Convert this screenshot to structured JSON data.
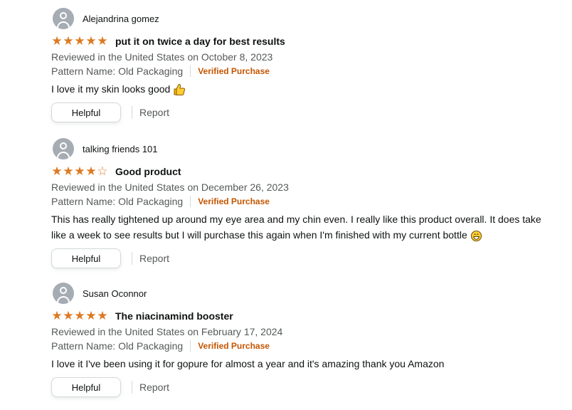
{
  "reviews": [
    {
      "profile_name": "Alejandrina gomez",
      "rating": 5,
      "title": "put it on twice a day for best results",
      "reviewed_line": "Reviewed in the United States on October 8, 2023",
      "pattern": "Pattern Name: Old Packaging",
      "verified": "Verified Purchase",
      "body": "I love it my skin looks good",
      "emoji": "thumbs-up",
      "helpful_label": "Helpful",
      "report_label": "Report"
    },
    {
      "profile_name": "talking friends 101",
      "rating": 4,
      "title": "Good product",
      "reviewed_line": "Reviewed in the United States on December 26, 2023",
      "pattern": "Pattern Name: Old Packaging",
      "verified": "Verified Purchase",
      "body": "This has really tightened up around my eye area and my chin even. I really like this product overall. It does take like a week to see results but I will purchase this again when I'm finished with my current bottle",
      "emoji": "grinning-face",
      "helpful_label": "Helpful",
      "report_label": "Report"
    },
    {
      "profile_name": "Susan Oconnor",
      "rating": 5,
      "title": "The niacinamind booster",
      "reviewed_line": "Reviewed in the United States on February 17, 2024",
      "pattern": "Pattern Name: Old Packaging",
      "verified": "Verified Purchase",
      "body": "I love it I've been using it for gopure for almost a year and it's amazing thank you Amazon",
      "emoji": "",
      "helpful_label": "Helpful",
      "report_label": "Report"
    }
  ],
  "colors": {
    "star": "#de7921",
    "verified": "#c45500",
    "muted_text": "#565959",
    "text": "#0f1111",
    "avatar": "#a6acb3"
  }
}
